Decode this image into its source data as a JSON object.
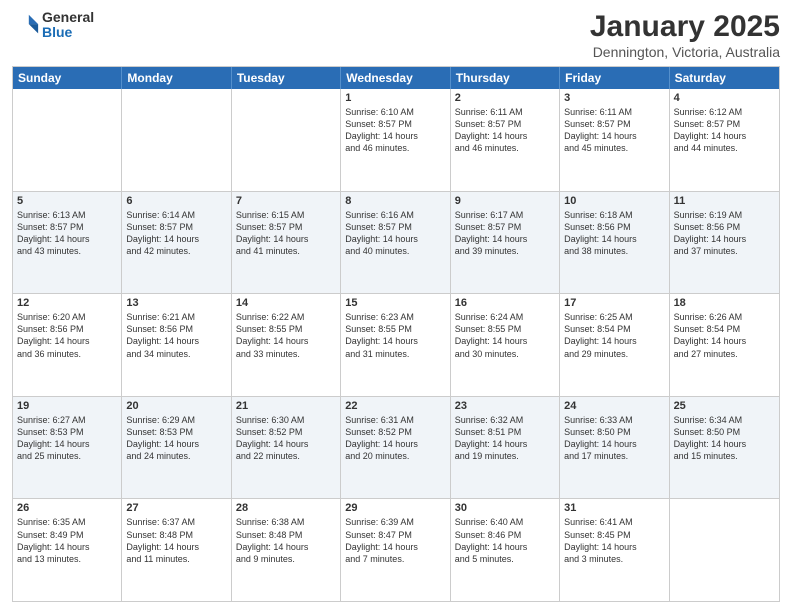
{
  "logo": {
    "general": "General",
    "blue": "Blue"
  },
  "title": "January 2025",
  "location": "Dennington, Victoria, Australia",
  "header_days": [
    "Sunday",
    "Monday",
    "Tuesday",
    "Wednesday",
    "Thursday",
    "Friday",
    "Saturday"
  ],
  "weeks": [
    [
      {
        "day": "",
        "text": ""
      },
      {
        "day": "",
        "text": ""
      },
      {
        "day": "",
        "text": ""
      },
      {
        "day": "1",
        "text": "Sunrise: 6:10 AM\nSunset: 8:57 PM\nDaylight: 14 hours\nand 46 minutes."
      },
      {
        "day": "2",
        "text": "Sunrise: 6:11 AM\nSunset: 8:57 PM\nDaylight: 14 hours\nand 46 minutes."
      },
      {
        "day": "3",
        "text": "Sunrise: 6:11 AM\nSunset: 8:57 PM\nDaylight: 14 hours\nand 45 minutes."
      },
      {
        "day": "4",
        "text": "Sunrise: 6:12 AM\nSunset: 8:57 PM\nDaylight: 14 hours\nand 44 minutes."
      }
    ],
    [
      {
        "day": "5",
        "text": "Sunrise: 6:13 AM\nSunset: 8:57 PM\nDaylight: 14 hours\nand 43 minutes."
      },
      {
        "day": "6",
        "text": "Sunrise: 6:14 AM\nSunset: 8:57 PM\nDaylight: 14 hours\nand 42 minutes."
      },
      {
        "day": "7",
        "text": "Sunrise: 6:15 AM\nSunset: 8:57 PM\nDaylight: 14 hours\nand 41 minutes."
      },
      {
        "day": "8",
        "text": "Sunrise: 6:16 AM\nSunset: 8:57 PM\nDaylight: 14 hours\nand 40 minutes."
      },
      {
        "day": "9",
        "text": "Sunrise: 6:17 AM\nSunset: 8:57 PM\nDaylight: 14 hours\nand 39 minutes."
      },
      {
        "day": "10",
        "text": "Sunrise: 6:18 AM\nSunset: 8:56 PM\nDaylight: 14 hours\nand 38 minutes."
      },
      {
        "day": "11",
        "text": "Sunrise: 6:19 AM\nSunset: 8:56 PM\nDaylight: 14 hours\nand 37 minutes."
      }
    ],
    [
      {
        "day": "12",
        "text": "Sunrise: 6:20 AM\nSunset: 8:56 PM\nDaylight: 14 hours\nand 36 minutes."
      },
      {
        "day": "13",
        "text": "Sunrise: 6:21 AM\nSunset: 8:56 PM\nDaylight: 14 hours\nand 34 minutes."
      },
      {
        "day": "14",
        "text": "Sunrise: 6:22 AM\nSunset: 8:55 PM\nDaylight: 14 hours\nand 33 minutes."
      },
      {
        "day": "15",
        "text": "Sunrise: 6:23 AM\nSunset: 8:55 PM\nDaylight: 14 hours\nand 31 minutes."
      },
      {
        "day": "16",
        "text": "Sunrise: 6:24 AM\nSunset: 8:55 PM\nDaylight: 14 hours\nand 30 minutes."
      },
      {
        "day": "17",
        "text": "Sunrise: 6:25 AM\nSunset: 8:54 PM\nDaylight: 14 hours\nand 29 minutes."
      },
      {
        "day": "18",
        "text": "Sunrise: 6:26 AM\nSunset: 8:54 PM\nDaylight: 14 hours\nand 27 minutes."
      }
    ],
    [
      {
        "day": "19",
        "text": "Sunrise: 6:27 AM\nSunset: 8:53 PM\nDaylight: 14 hours\nand 25 minutes."
      },
      {
        "day": "20",
        "text": "Sunrise: 6:29 AM\nSunset: 8:53 PM\nDaylight: 14 hours\nand 24 minutes."
      },
      {
        "day": "21",
        "text": "Sunrise: 6:30 AM\nSunset: 8:52 PM\nDaylight: 14 hours\nand 22 minutes."
      },
      {
        "day": "22",
        "text": "Sunrise: 6:31 AM\nSunset: 8:52 PM\nDaylight: 14 hours\nand 20 minutes."
      },
      {
        "day": "23",
        "text": "Sunrise: 6:32 AM\nSunset: 8:51 PM\nDaylight: 14 hours\nand 19 minutes."
      },
      {
        "day": "24",
        "text": "Sunrise: 6:33 AM\nSunset: 8:50 PM\nDaylight: 14 hours\nand 17 minutes."
      },
      {
        "day": "25",
        "text": "Sunrise: 6:34 AM\nSunset: 8:50 PM\nDaylight: 14 hours\nand 15 minutes."
      }
    ],
    [
      {
        "day": "26",
        "text": "Sunrise: 6:35 AM\nSunset: 8:49 PM\nDaylight: 14 hours\nand 13 minutes."
      },
      {
        "day": "27",
        "text": "Sunrise: 6:37 AM\nSunset: 8:48 PM\nDaylight: 14 hours\nand 11 minutes."
      },
      {
        "day": "28",
        "text": "Sunrise: 6:38 AM\nSunset: 8:48 PM\nDaylight: 14 hours\nand 9 minutes."
      },
      {
        "day": "29",
        "text": "Sunrise: 6:39 AM\nSunset: 8:47 PM\nDaylight: 14 hours\nand 7 minutes."
      },
      {
        "day": "30",
        "text": "Sunrise: 6:40 AM\nSunset: 8:46 PM\nDaylight: 14 hours\nand 5 minutes."
      },
      {
        "day": "31",
        "text": "Sunrise: 6:41 AM\nSunset: 8:45 PM\nDaylight: 14 hours\nand 3 minutes."
      },
      {
        "day": "",
        "text": ""
      }
    ]
  ]
}
